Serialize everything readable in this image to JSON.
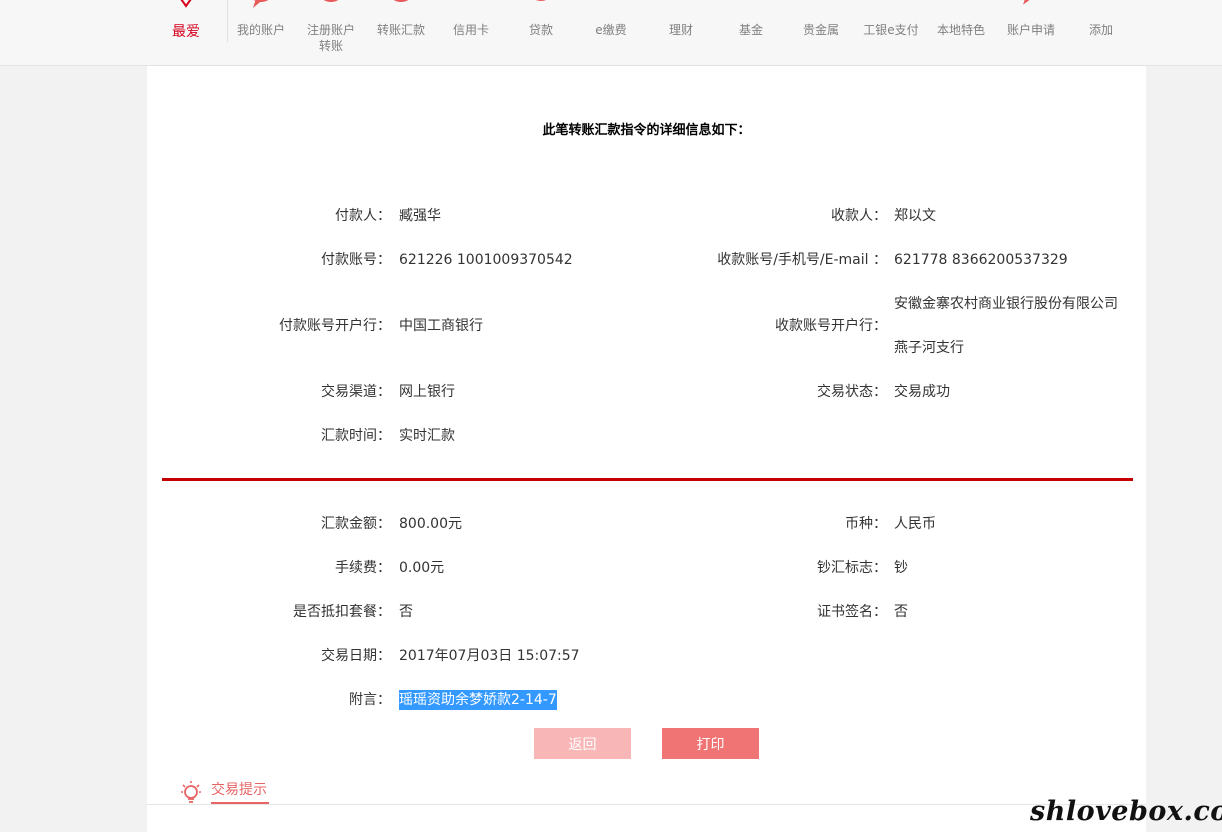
{
  "nav": {
    "items": [
      {
        "label": "最爱",
        "icon": "heart-icon",
        "active": true
      },
      {
        "label": "我的账户",
        "icon": "account-icon"
      },
      {
        "label": "注册账户转账",
        "icon": "register-transfer-icon"
      },
      {
        "label": "转账汇款",
        "icon": "transfer-icon"
      },
      {
        "label": "信用卡",
        "icon": "credit-card-icon"
      },
      {
        "label": "贷款",
        "icon": "loan-icon"
      },
      {
        "label": "e缴费",
        "icon": "lightning-icon"
      },
      {
        "label": "理财",
        "icon": "wallet-icon"
      },
      {
        "label": "基金",
        "icon": "fund-icon"
      },
      {
        "label": "贵金属",
        "icon": "gold-icon"
      },
      {
        "label": "工银e支付",
        "icon": "epay-icon"
      },
      {
        "label": "本地特色",
        "icon": "local-icon"
      },
      {
        "label": "账户申请",
        "icon": "apply-icon"
      },
      {
        "label": "添加",
        "icon": "add-icon"
      }
    ]
  },
  "detail": {
    "title": "此笔转账汇款指令的详细信息如下：",
    "payer_label": "付款人：",
    "payer": "臧强华",
    "payee_label": "收款人：",
    "payee": "郑以文",
    "payer_account_label": "付款账号：",
    "payer_account": "621226 1001009370542",
    "payee_account_label": "收款账号/手机号/E-mail ：",
    "payee_account": "621778 8366200537329",
    "payer_bank_label": "付款账号开户行：",
    "payer_bank": "中国工商银行",
    "payee_bank_label": "收款账号开户行：",
    "payee_bank_line1": "安徽金寨农村商业银行股份有限公司",
    "payee_bank_line2": "燕子河支行",
    "channel_label": "交易渠道：",
    "channel": "网上银行",
    "status_label": "交易状态：",
    "status": "交易成功",
    "remit_time_label": "汇款时间：",
    "remit_time": "实时汇款",
    "amount_label": "汇款金额：",
    "amount": "800.00元",
    "currency_label": "币种：",
    "currency": "人民币",
    "fee_label": "手续费：",
    "fee": "0.00元",
    "cash_flag_label": "钞汇标志：",
    "cash_flag": "钞",
    "package_label": "是否抵扣套餐：",
    "package": "否",
    "cert_sign_label": "证书签名：",
    "cert_sign": "否",
    "date_label": "交易日期：",
    "date": "2017年07月03日 15:07:57",
    "note_label": "附言：",
    "note": "瑶瑶资助余梦娇款2-14-7"
  },
  "buttons": {
    "back": "返回",
    "print": "打印"
  },
  "tips": {
    "label": "交易提示",
    "icon": "lightbulb-icon"
  },
  "watermark": "shlovebox.com",
  "colors": {
    "brand_red": "#c40000",
    "active_red": "#d6001c",
    "back_button": "#f9b6b6",
    "print_button": "#f07474",
    "selection": "#3399ff"
  }
}
